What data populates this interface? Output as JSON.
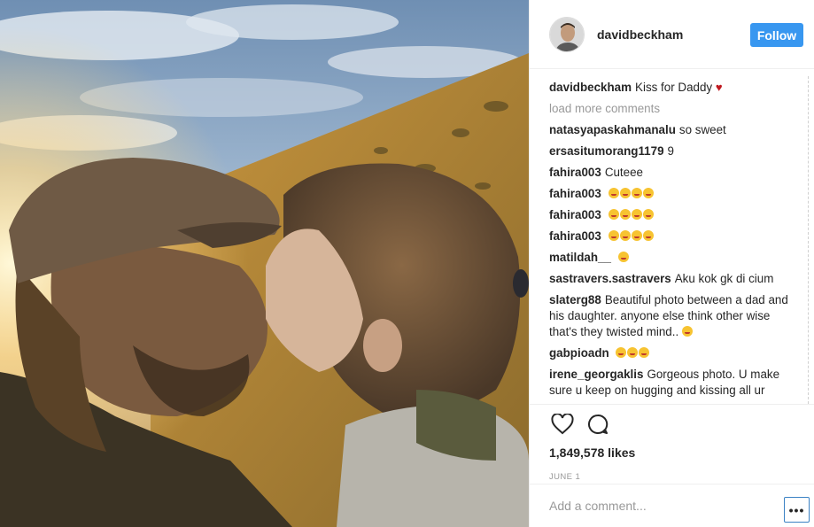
{
  "post": {
    "author": "davidbeckham",
    "follow_label": "Follow",
    "caption": {
      "user": "davidbeckham",
      "text": "Kiss for Daddy",
      "heart": "♥"
    },
    "load_more_label": "load more comments",
    "comments": [
      {
        "user": "natasyapaskahmanalu",
        "text": "so sweet"
      },
      {
        "user": "ersasitumorang1179",
        "text": "9"
      },
      {
        "user": "fahira003",
        "text": "Cuteee"
      },
      {
        "user": "fahira003",
        "text": "",
        "emoji_count": 4
      },
      {
        "user": "fahira003",
        "text": "",
        "emoji_count": 4
      },
      {
        "user": "fahira003",
        "text": "",
        "emoji_count": 4
      },
      {
        "user": "matildah__",
        "text": "",
        "emoji_count": 1
      },
      {
        "user": "sastravers.sastravers",
        "text": "Aku kok gk di cium"
      },
      {
        "user": "slaterg88",
        "text": "Beautiful photo between a dad and his daughter. anyone else think other wise that's they twisted mind..",
        "emoji_count": 1
      },
      {
        "user": "gabpioadn",
        "text": "",
        "emoji_count": 3
      },
      {
        "user": "irene_georgaklis",
        "text": "Gorgeous photo. U make sure u keep on hugging and kissing all ur"
      }
    ],
    "likes": "1,849,578 likes",
    "date": "JUNE 1",
    "add_comment_placeholder": "Add a comment...",
    "more_label": "•••",
    "icons": {
      "like": "heart-outline-icon",
      "comment": "speech-bubble-icon",
      "more": "ellipsis-icon"
    },
    "colors": {
      "follow_bg": "#3897f0",
      "heart": "#c0181f",
      "muted": "#999999"
    }
  }
}
